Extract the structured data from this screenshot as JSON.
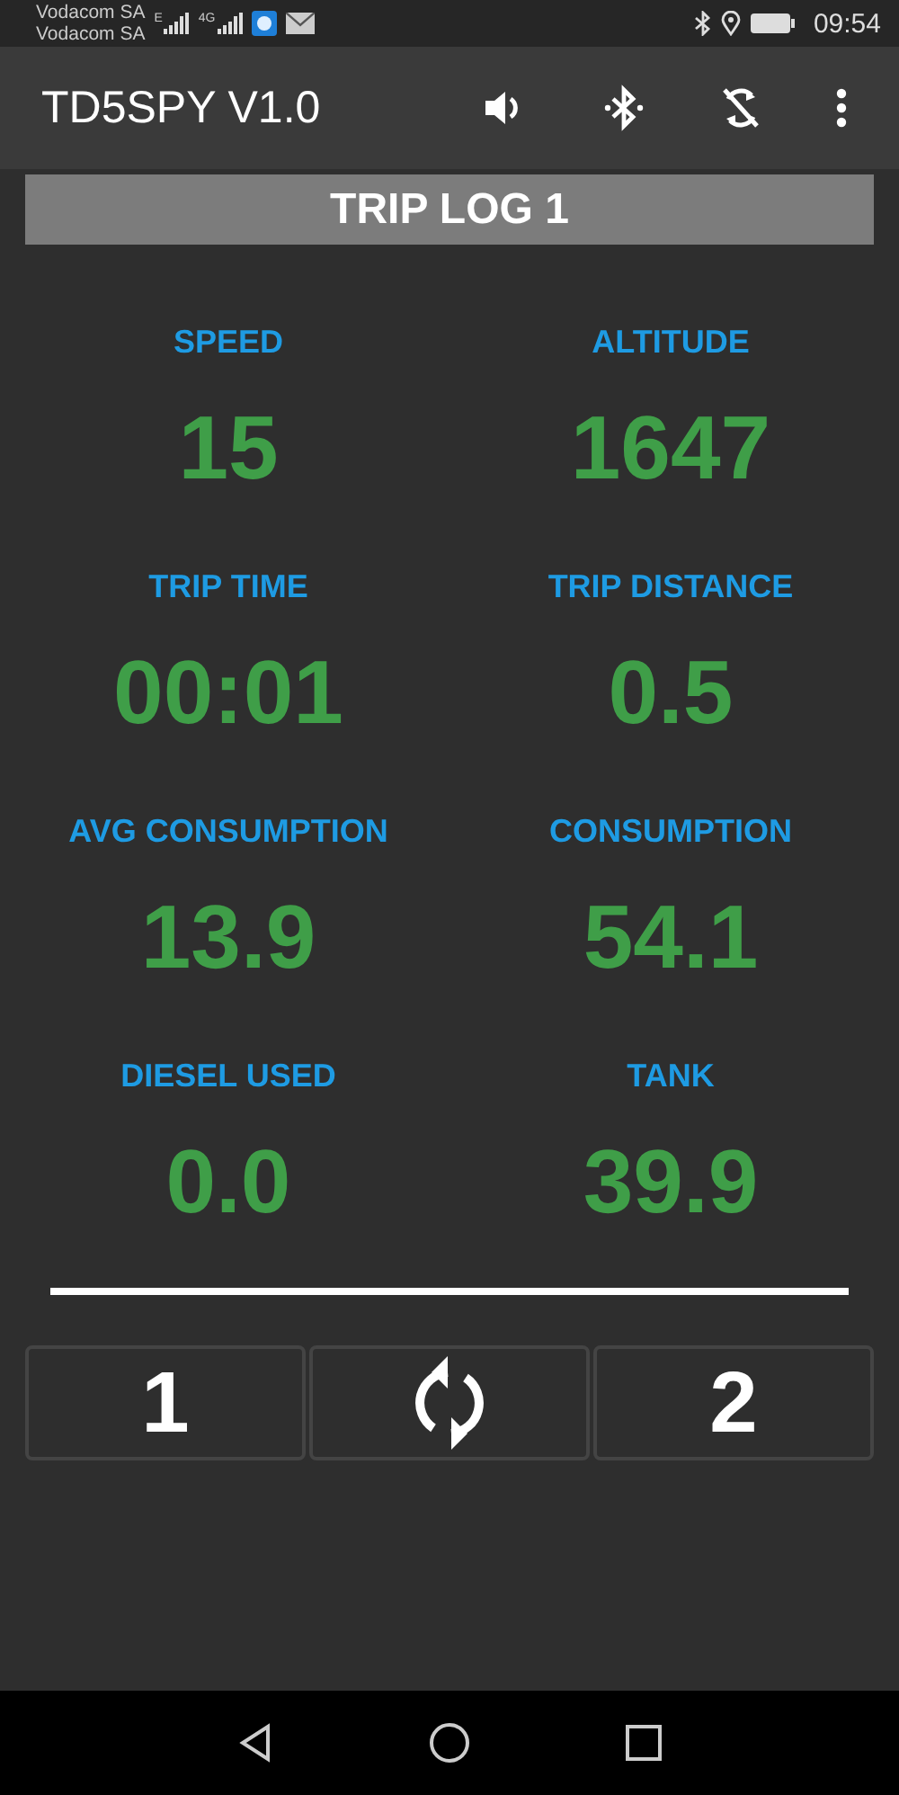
{
  "status_bar": {
    "carriers": [
      "Vodacom SA",
      "Vodacom SA"
    ],
    "network_badges": [
      "E",
      "4G"
    ],
    "time": "09:54"
  },
  "app_bar": {
    "title": "TD5SPY V1.0"
  },
  "header": "TRIP LOG 1",
  "metrics": [
    {
      "label": "SPEED",
      "value": "15"
    },
    {
      "label": "ALTITUDE",
      "value": "1647"
    },
    {
      "label": "TRIP TIME",
      "value": "00:01"
    },
    {
      "label": "TRIP DISTANCE",
      "value": "0.5"
    },
    {
      "label": "AVG CONSUMPTION",
      "value": "13.9"
    },
    {
      "label": "CONSUMPTION",
      "value": "54.1"
    },
    {
      "label": "DIESEL USED",
      "value": "0.0"
    },
    {
      "label": "TANK",
      "value": "39.9"
    }
  ],
  "buttons": [
    {
      "kind": "text",
      "label": "1"
    },
    {
      "kind": "refresh"
    },
    {
      "kind": "text",
      "label": "2"
    }
  ]
}
